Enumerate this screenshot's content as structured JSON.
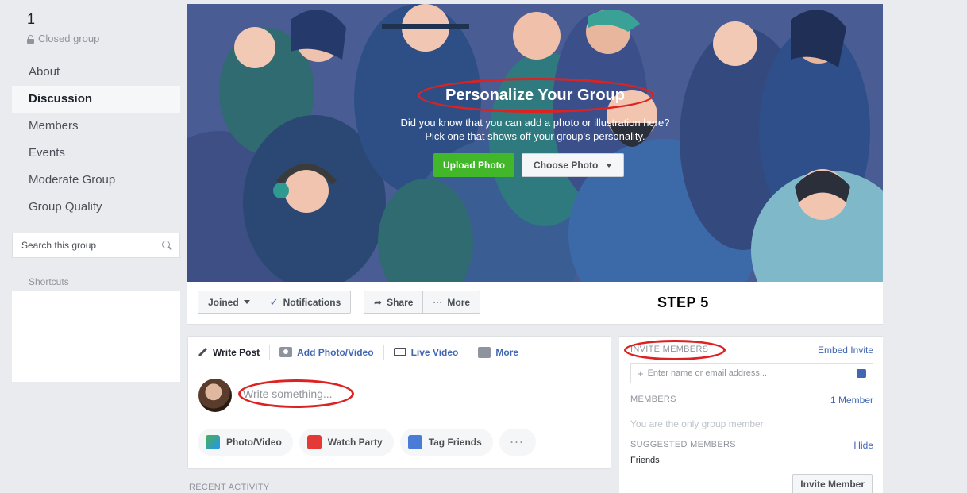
{
  "group": {
    "name": "1",
    "privacy": "Closed group"
  },
  "sidebar": {
    "items": [
      {
        "label": "About",
        "active": false
      },
      {
        "label": "Discussion",
        "active": true
      },
      {
        "label": "Members",
        "active": false
      },
      {
        "label": "Events",
        "active": false
      },
      {
        "label": "Moderate Group",
        "active": false
      },
      {
        "label": "Group Quality",
        "active": false
      }
    ],
    "search_placeholder": "Search this group",
    "shortcuts_label": "Shortcuts"
  },
  "cover": {
    "title": "Personalize Your Group",
    "subtitle_line1": "Did you know that you can add a photo or illustration here?",
    "subtitle_line2": "Pick one that shows off your group's personality.",
    "upload_label": "Upload Photo",
    "choose_label": "Choose Photo",
    "colors": {
      "background": "#4a5c94",
      "upload": "#42b72a"
    }
  },
  "actionbar": {
    "joined": "Joined",
    "notifications": "Notifications",
    "share": "Share",
    "more": "More",
    "step": "STEP 5"
  },
  "composer": {
    "tabs": [
      "Write Post",
      "Add Photo/Video",
      "Live Video",
      "More"
    ],
    "placeholder": "Write something...",
    "actions": [
      "Photo/Video",
      "Watch Party",
      "Tag Friends"
    ],
    "more_dots": "···"
  },
  "recent_activity": "RECENT ACTIVITY",
  "invite": {
    "heading": "INVITE MEMBERS",
    "embed": "Embed Invite",
    "input_placeholder": "Enter name or email address...",
    "members_heading": "MEMBERS",
    "members_count": "1 Member",
    "only_member": "You are the only group member",
    "suggested_heading": "SUGGESTED MEMBERS",
    "hide": "Hide",
    "friends": "Friends",
    "invite_button": "Invite Member"
  },
  "annotation_color": "#dd2222"
}
